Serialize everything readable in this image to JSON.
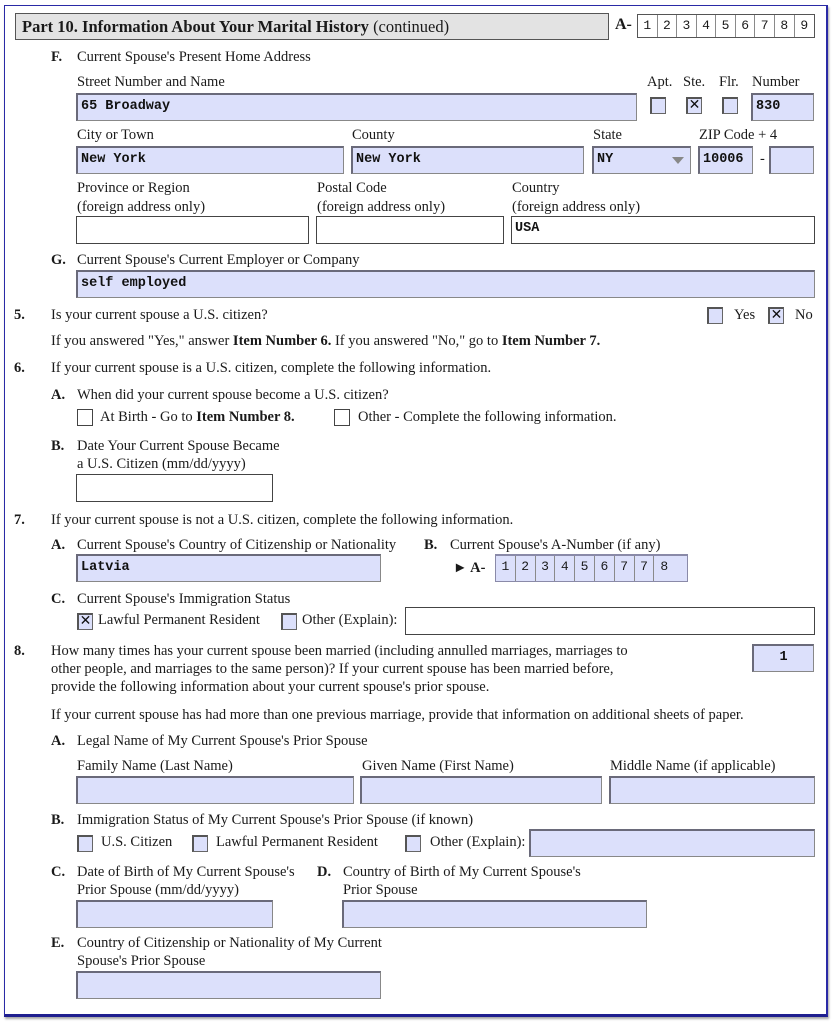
{
  "header": {
    "title_bold": "Part 10.  Information About Your Marital History",
    "title_normal": " (continued)",
    "a_number_label": "A-",
    "a_number_digits": [
      "1",
      "2",
      "3",
      "4",
      "5",
      "6",
      "7",
      "8",
      "9"
    ]
  },
  "itemF": {
    "letter": "F.",
    "title": "Current Spouse's Present Home Address",
    "street_label": "Street Number and Name",
    "street_value": "65 Broadway",
    "apt_label": "Apt.",
    "ste_label": "Ste.",
    "flr_label": "Flr.",
    "apt_checked": "",
    "ste_checked": "✕",
    "flr_checked": "",
    "number_label": "Number",
    "number_value": "830",
    "city_label": "City or Town",
    "city_value": "New York",
    "county_label": "County",
    "county_value": "New York",
    "state_label": "State",
    "state_value": "NY",
    "zip_label": "ZIP Code + 4",
    "zip_value": "10006",
    "zip_dash": "-",
    "zip4_value": "",
    "province_label_1": "Province or Region",
    "province_label_2": "(foreign address only)",
    "province_value": "",
    "postal_label_1": "Postal Code",
    "postal_label_2": "(foreign address only)",
    "postal_value": "",
    "country_label_1": "Country",
    "country_label_2": "(foreign address only)",
    "country_value": "USA"
  },
  "itemG": {
    "letter": "G.",
    "title": "Current Spouse's Current Employer or Company",
    "value": "self employed"
  },
  "item5": {
    "number": "5.",
    "question": "Is your current spouse a U.S. citizen?",
    "yes_label": "Yes",
    "no_label": "No",
    "yes_checked": "",
    "no_checked": "✕",
    "note_1": "If you answered \"Yes,\" answer ",
    "note_b1": "Item Number 6.",
    "note_2": "  If you answered \"No,\" go to ",
    "note_b2": "Item Number 7."
  },
  "item6": {
    "number": "6.",
    "text": "If your current spouse is a U.S. citizen, complete the following information.",
    "a_letter": "A.",
    "a_text": "When did your current spouse become a U.S. citizen?",
    "at_birth_1": "At Birth - Go to ",
    "at_birth_b": "Item Number 8.",
    "other_1": "Other",
    "other_2": " - Complete the following information.",
    "b_letter": "B.",
    "b_text_1": "Date Your Current Spouse Became",
    "b_text_2": "a U.S. Citizen (mm/dd/yyyy)",
    "b_value": ""
  },
  "item7": {
    "number": "7.",
    "text": "If your current spouse is not a U.S. citizen, complete the following information.",
    "a_letter": "A.",
    "a_text": "Current Spouse's Country of Citizenship or Nationality",
    "a_value": "Latvia",
    "b_letter": "B.",
    "b_text": "Current Spouse's A-Number (if any)",
    "b_prefix": "► A-",
    "b_digits": [
      "1",
      "2",
      "3",
      "4",
      "5",
      "6",
      "7",
      "7",
      "8"
    ],
    "c_letter": "C.",
    "c_text": "Current Spouse's Immigration Status",
    "lpr_label": "Lawful Permanent Resident",
    "lpr_checked": "✕",
    "other_label": "Other (Explain):",
    "other_checked": "",
    "other_value": ""
  },
  "item8": {
    "number": "8.",
    "text_1": "How many times has your current spouse been married (including annulled marriages, marriages to",
    "text_2": "other people, and marriages to the same person)?  If your current spouse has been married before,",
    "text_3": "provide the following information about your current spouse's prior spouse.",
    "times_value": "1",
    "note": "If your current spouse has had more than one previous marriage, provide that information on additional sheets of paper.",
    "a_letter": "A.",
    "a_text": "Legal Name of My Current Spouse's Prior Spouse",
    "family_label": "Family Name (Last Name)",
    "given_label": "Given Name (First Name)",
    "middle_label": "Middle Name (if applicable)",
    "family_value": "",
    "given_value": "",
    "middle_value": "",
    "b_letter": "B.",
    "b_text": "Immigration Status of My Current Spouse's Prior Spouse (if known)",
    "uscit_label": "U.S. Citizen",
    "lpr_label": "Lawful Permanent Resident",
    "other_label": "Other (Explain):",
    "other_value": "",
    "c_letter": "C.",
    "c_text_1": "Date of Birth of My Current Spouse's",
    "c_text_2": "Prior Spouse (mm/dd/yyyy)",
    "c_value": "",
    "d_letter": "D.",
    "d_text_1": "Country of Birth of My Current Spouse's",
    "d_text_2": "Prior Spouse",
    "d_value": "",
    "e_letter": "E.",
    "e_text_1": "Country of Citizenship or Nationality of My Current",
    "e_text_2": "Spouse's Prior Spouse",
    "e_value": ""
  }
}
